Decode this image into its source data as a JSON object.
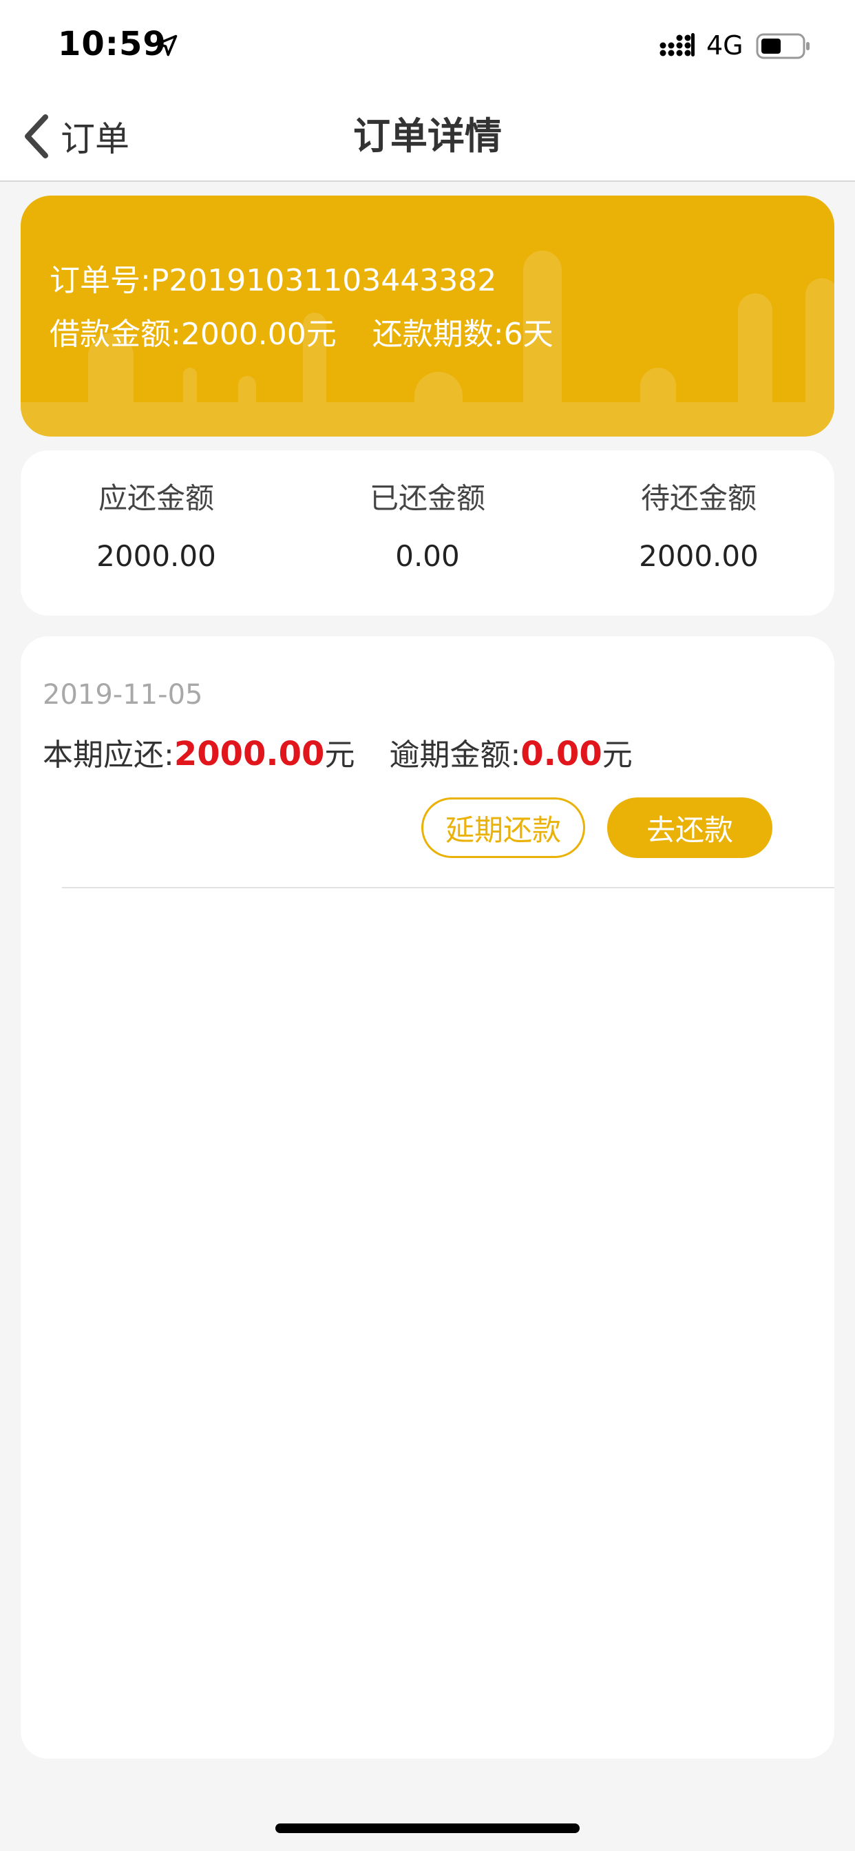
{
  "status_bar": {
    "time": "10:59",
    "network": "4G",
    "location_icon": "location-arrow-icon",
    "signal_icon": "signal-icon",
    "battery_icon": "battery-icon",
    "battery_level": 0.5
  },
  "nav": {
    "back_label": "订单",
    "title": "订单详情",
    "back_icon": "chevron-left-icon"
  },
  "order": {
    "number_label": "订单号:",
    "number": "P20191031103443382",
    "loan_label": "借款金额:",
    "loan_amount": "2000.00元",
    "term_label": "还款期数:",
    "term": "6天"
  },
  "summary": {
    "items": [
      {
        "label": "应还金额",
        "value": "2000.00"
      },
      {
        "label": "已还金额",
        "value": "0.00"
      },
      {
        "label": "待还金额",
        "value": "2000.00"
      }
    ]
  },
  "installment": {
    "date": "2019-11-05",
    "due_label": "本期应还:",
    "due_amount": "2000.00",
    "due_unit": "元",
    "overdue_label": "逾期金额:",
    "overdue_amount": "0.00",
    "overdue_unit": "元",
    "delay_button": "延期还款",
    "pay_button": "去还款"
  },
  "colors": {
    "accent": "#eab107",
    "danger": "#e1161c",
    "background": "#f5f5f5"
  }
}
